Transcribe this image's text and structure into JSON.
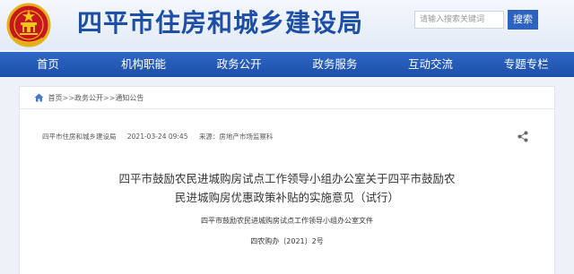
{
  "header": {
    "site_title": "四平市住房和城乡建设局",
    "emblem_icon": "national-emblem-icon",
    "search_placeholder": "请输入搜索关键词",
    "search_button": "搜索"
  },
  "nav": {
    "items": [
      {
        "label": "首页"
      },
      {
        "label": "机构职能"
      },
      {
        "label": "政务公开"
      },
      {
        "label": "政务服务"
      },
      {
        "label": "互动交流"
      },
      {
        "label": "专题专栏"
      }
    ]
  },
  "breadcrumb": {
    "home_icon": "home-icon",
    "items": [
      "首页",
      "政务公开",
      "通知公告"
    ],
    "separator": ">>"
  },
  "article": {
    "source": "四平市住房和城乡建设局",
    "datetime": "2021-03-24 09:45",
    "department": "来源：房地产市场监察科",
    "share_icon": "share-icon",
    "title_line1": "四平市鼓励农民进城购房试点工作领导小组办公室关于四平市鼓励农",
    "title_line2": "民进城购房优惠政策补贴的实施意见（试行）",
    "issuer": "四平市鼓励农民进城购房试点工作领导小组办公室文件",
    "doc_number": "四农购办〔2021〕2号"
  },
  "colors": {
    "primary": "#1e4fa6",
    "nav_bg": "#2856b6",
    "page_bg": "#eef2f8"
  }
}
